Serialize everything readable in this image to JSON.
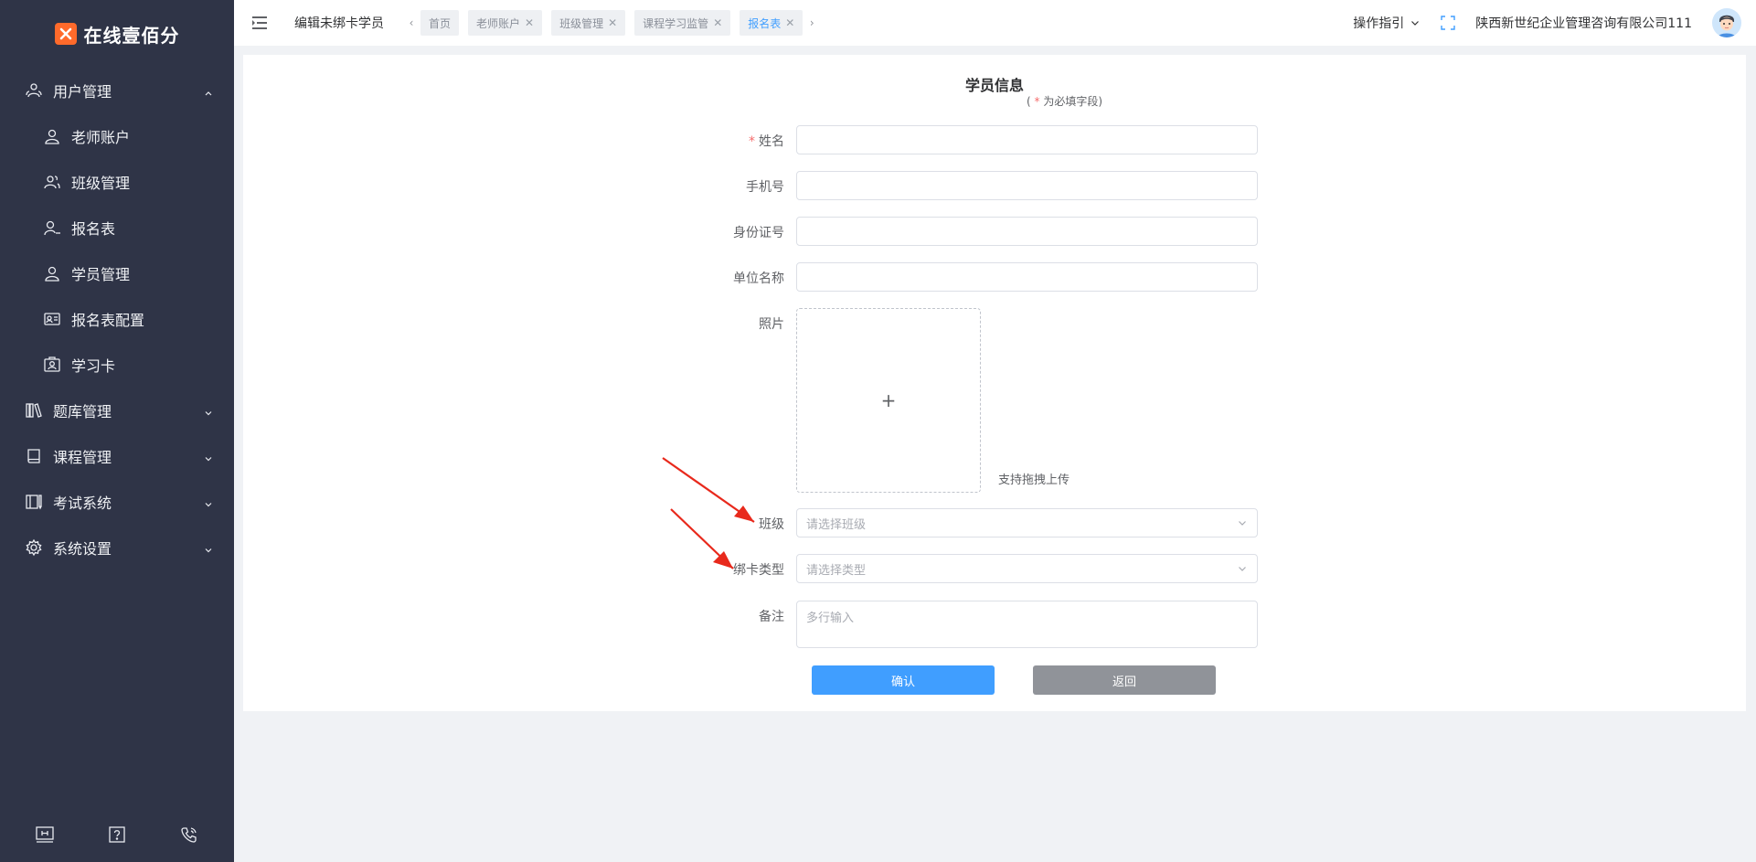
{
  "brand": {
    "name": "在线壹佰分",
    "accent": "#ff6a2b"
  },
  "sidebar": {
    "groups": [
      {
        "label": "用户管理",
        "icon": "users-icon",
        "expanded": true,
        "items": [
          {
            "label": "老师账户",
            "icon": "user-icon"
          },
          {
            "label": "班级管理",
            "icon": "group-icon"
          },
          {
            "label": "报名表",
            "icon": "user-minus-icon"
          },
          {
            "label": "学员管理",
            "icon": "user-icon"
          },
          {
            "label": "报名表配置",
            "icon": "id-card-icon"
          },
          {
            "label": "学习卡",
            "icon": "card-icon"
          }
        ]
      },
      {
        "label": "题库管理",
        "icon": "books-icon",
        "expanded": false
      },
      {
        "label": "课程管理",
        "icon": "book-icon",
        "expanded": false
      },
      {
        "label": "考试系统",
        "icon": "exam-icon",
        "expanded": false
      },
      {
        "label": "系统设置",
        "icon": "gear-icon",
        "expanded": false
      }
    ],
    "footer_icons": [
      "screen-icon",
      "help-icon",
      "phone-icon"
    ]
  },
  "header": {
    "page_title": "编辑未绑卡学员",
    "tabs": [
      {
        "label": "首页",
        "closable": false,
        "active": false
      },
      {
        "label": "老师账户",
        "closable": true,
        "active": false
      },
      {
        "label": "班级管理",
        "closable": true,
        "active": false
      },
      {
        "label": "课程学习监管",
        "closable": true,
        "active": false
      },
      {
        "label": "报名表",
        "closable": true,
        "active": true
      }
    ],
    "guide_label": "操作指引",
    "company": "陕西新世纪企业管理咨询有限公司111"
  },
  "form": {
    "title": "学员信息",
    "subtitle_prefix": "( ",
    "subtitle_star": "*",
    "subtitle_suffix": " 为必填字段)",
    "fields": {
      "name": {
        "label": "姓名",
        "required_mark": "*"
      },
      "phone": {
        "label": "手机号"
      },
      "id_number": {
        "label": "身份证号"
      },
      "company": {
        "label": "单位名称"
      },
      "photo": {
        "label": "照片",
        "plus": "+",
        "hint": "支持拖拽上传"
      },
      "class": {
        "label": "班级",
        "placeholder": "请选择班级"
      },
      "card_type": {
        "label": "绑卡类型",
        "placeholder": "请选择类型"
      },
      "remark": {
        "label": "备注",
        "placeholder": "多行输入"
      }
    },
    "confirm_label": "确认",
    "back_label": "返回"
  },
  "colors": {
    "sidebar_bg": "#2f3447",
    "primary": "#409eff",
    "back_button": "#909399",
    "required": "#f56c6c",
    "annotation_arrow": "#e8291c"
  }
}
